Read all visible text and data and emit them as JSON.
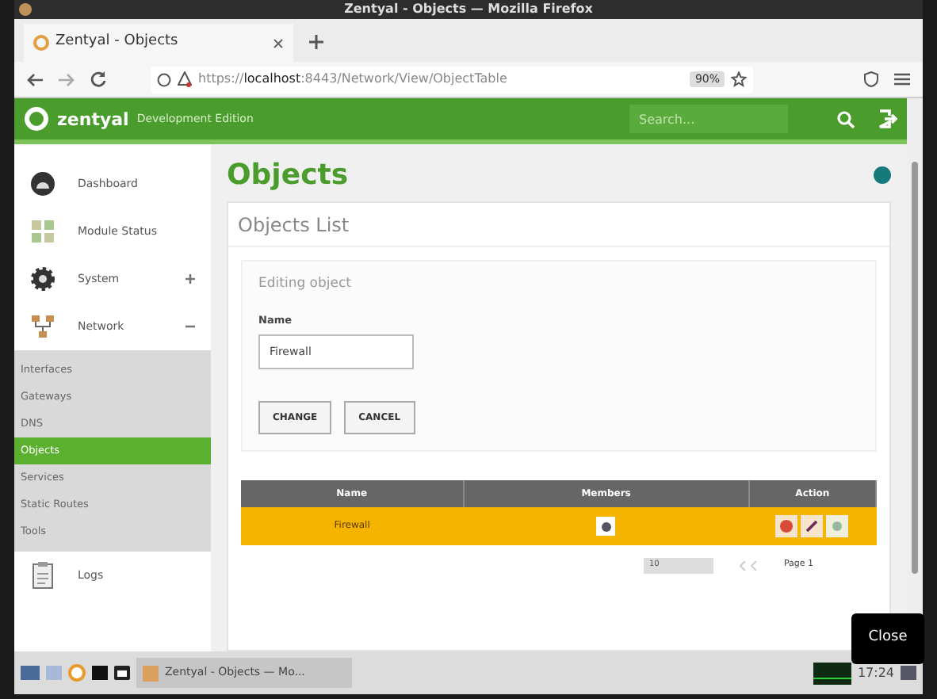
{
  "window": {
    "title": "Zentyal - Objects — Mozilla Firefox"
  },
  "browser": {
    "tab": "Zentyal - Objects",
    "url_prefix": "https://",
    "url_host": "localhost",
    "url_rest": ":8443/Network/View/ObjectTable",
    "zoom": "90%"
  },
  "header": {
    "brand": "zentyal",
    "edition": "Development Edition",
    "search": {
      "placeholder": "Search..."
    }
  },
  "sidebar": {
    "items": [
      {
        "label": "Dashboard",
        "kind": "dashboard"
      },
      {
        "label": "Module Status",
        "kind": "modules"
      },
      {
        "label": "System",
        "kind": "gear",
        "expanded": false
      },
      {
        "label": "Network",
        "kind": "network",
        "expanded": true,
        "children": [
          {
            "label": "Interfaces",
            "selected": false
          },
          {
            "label": "Gateways",
            "selected": false
          },
          {
            "label": "DNS",
            "selected": false
          },
          {
            "label": "Objects",
            "selected": true
          },
          {
            "label": "Services",
            "selected": false
          },
          {
            "label": "Static Routes",
            "selected": false
          },
          {
            "label": "Tools",
            "selected": false
          }
        ]
      },
      {
        "label": "Logs",
        "kind": "clipboard"
      }
    ]
  },
  "page": {
    "title": "Objects",
    "panel_title": "Objects List",
    "form": {
      "legend": "Editing object",
      "field_label": "Name",
      "field_value": "Firewall",
      "buttons": [
        "CHANGE",
        "CANCEL"
      ]
    },
    "table": {
      "columns": [
        "Name",
        "Members",
        "Action"
      ],
      "rows": [
        {
          "name": "Firewall",
          "selected": true
        }
      ]
    },
    "pagination": {
      "page_size": "10",
      "page_label": "Page 1"
    }
  },
  "tooltip": "Close",
  "taskbar": {
    "window_button": "Zentyal - Objects — Mo...",
    "clock": "17:24"
  }
}
